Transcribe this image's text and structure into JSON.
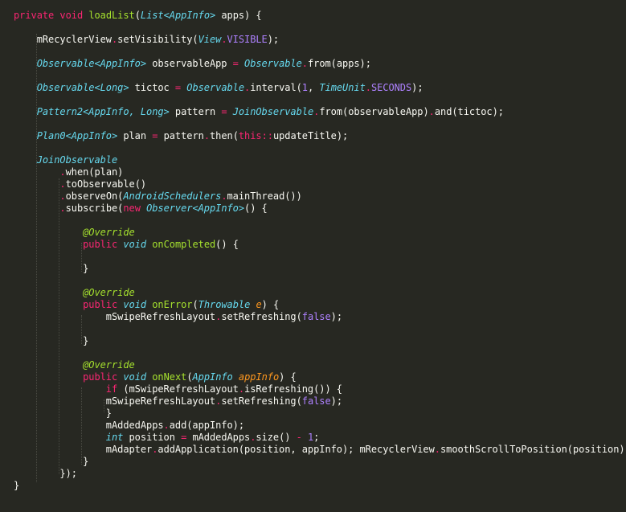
{
  "theme": {
    "background": "#272822",
    "keyword": "#f92672",
    "type": "#66d9ef",
    "function": "#a6e22e",
    "parameter": "#fd971f",
    "constant": "#ae81ff",
    "text": "#f8f8f2"
  },
  "code_lines": [
    [
      [
        "kw",
        "private"
      ],
      [
        "text",
        " "
      ],
      [
        "kw",
        "void"
      ],
      [
        "text",
        " "
      ],
      [
        "func",
        "loadList"
      ],
      [
        "text",
        "("
      ],
      [
        "type",
        "List<AppInfo>"
      ],
      [
        "text",
        " apps) {"
      ]
    ],
    [],
    [
      [
        "text",
        "    mRecyclerView"
      ],
      [
        "kw",
        "."
      ],
      [
        "text",
        "setVisibility("
      ],
      [
        "type",
        "View"
      ],
      [
        "kw",
        "."
      ],
      [
        "const",
        "VISIBLE"
      ],
      [
        "text",
        ");"
      ]
    ],
    [],
    [
      [
        "text",
        "    "
      ],
      [
        "type",
        "Observable<AppInfo>"
      ],
      [
        "text",
        " observableApp "
      ],
      [
        "kw",
        "="
      ],
      [
        "text",
        " "
      ],
      [
        "type",
        "Observable"
      ],
      [
        "kw",
        "."
      ],
      [
        "text",
        "from(apps);"
      ]
    ],
    [],
    [
      [
        "text",
        "    "
      ],
      [
        "type",
        "Observable<Long>"
      ],
      [
        "text",
        " tictoc "
      ],
      [
        "kw",
        "="
      ],
      [
        "text",
        " "
      ],
      [
        "type",
        "Observable"
      ],
      [
        "kw",
        "."
      ],
      [
        "text",
        "interval("
      ],
      [
        "const",
        "1"
      ],
      [
        "text",
        ", "
      ],
      [
        "type",
        "TimeUnit"
      ],
      [
        "kw",
        "."
      ],
      [
        "const",
        "SECONDS"
      ],
      [
        "text",
        ");"
      ]
    ],
    [],
    [
      [
        "text",
        "    "
      ],
      [
        "type",
        "Pattern2<AppInfo, Long>"
      ],
      [
        "text",
        " pattern "
      ],
      [
        "kw",
        "="
      ],
      [
        "text",
        " "
      ],
      [
        "type",
        "JoinObservable"
      ],
      [
        "kw",
        "."
      ],
      [
        "text",
        "from(observableApp)"
      ],
      [
        "kw",
        "."
      ],
      [
        "text",
        "and(tictoc);"
      ]
    ],
    [],
    [
      [
        "text",
        "    "
      ],
      [
        "type",
        "Plan0<AppInfo>"
      ],
      [
        "text",
        " plan "
      ],
      [
        "kw",
        "="
      ],
      [
        "text",
        " pattern"
      ],
      [
        "kw",
        "."
      ],
      [
        "text",
        "then("
      ],
      [
        "kw",
        "this"
      ],
      [
        "kw",
        "::"
      ],
      [
        "text",
        "updateTitle);"
      ]
    ],
    [],
    [
      [
        "text",
        "    "
      ],
      [
        "type",
        "JoinObservable"
      ]
    ],
    [
      [
        "text",
        "        "
      ],
      [
        "kw",
        "."
      ],
      [
        "text",
        "when(plan)"
      ]
    ],
    [
      [
        "text",
        "        "
      ],
      [
        "kw",
        "."
      ],
      [
        "text",
        "toObservable()"
      ]
    ],
    [
      [
        "text",
        "        "
      ],
      [
        "kw",
        "."
      ],
      [
        "text",
        "observeOn("
      ],
      [
        "type",
        "AndroidSchedulers"
      ],
      [
        "kw",
        "."
      ],
      [
        "text",
        "mainThread())"
      ]
    ],
    [
      [
        "text",
        "        "
      ],
      [
        "kw",
        "."
      ],
      [
        "text",
        "subscribe("
      ],
      [
        "kw",
        "new"
      ],
      [
        "text",
        " "
      ],
      [
        "type",
        "Observer<AppInfo>"
      ],
      [
        "text",
        "() {"
      ]
    ],
    [],
    [
      [
        "text",
        "            "
      ],
      [
        "anno",
        "@Override"
      ]
    ],
    [
      [
        "text",
        "            "
      ],
      [
        "kw",
        "public"
      ],
      [
        "text",
        " "
      ],
      [
        "type",
        "void"
      ],
      [
        "text",
        " "
      ],
      [
        "func",
        "onCompleted"
      ],
      [
        "text",
        "() {"
      ]
    ],
    [],
    [
      [
        "text",
        "            }"
      ]
    ],
    [],
    [
      [
        "text",
        "            "
      ],
      [
        "anno",
        "@Override"
      ]
    ],
    [
      [
        "text",
        "            "
      ],
      [
        "kw",
        "public"
      ],
      [
        "text",
        " "
      ],
      [
        "type",
        "void"
      ],
      [
        "text",
        " "
      ],
      [
        "func",
        "onError"
      ],
      [
        "text",
        "("
      ],
      [
        "type",
        "Throwable"
      ],
      [
        "text",
        " "
      ],
      [
        "param",
        "e"
      ],
      [
        "text",
        ") {"
      ]
    ],
    [
      [
        "text",
        "                mSwipeRefreshLayout"
      ],
      [
        "kw",
        "."
      ],
      [
        "text",
        "setRefreshing("
      ],
      [
        "const",
        "false"
      ],
      [
        "text",
        ");"
      ]
    ],
    [],
    [
      [
        "text",
        "            }"
      ]
    ],
    [],
    [
      [
        "text",
        "            "
      ],
      [
        "anno",
        "@Override"
      ]
    ],
    [
      [
        "text",
        "            "
      ],
      [
        "kw",
        "public"
      ],
      [
        "text",
        " "
      ],
      [
        "type",
        "void"
      ],
      [
        "text",
        " "
      ],
      [
        "func",
        "onNext"
      ],
      [
        "text",
        "("
      ],
      [
        "type",
        "AppInfo"
      ],
      [
        "text",
        " "
      ],
      [
        "param",
        "appInfo"
      ],
      [
        "text",
        ") {"
      ]
    ],
    [
      [
        "text",
        "                "
      ],
      [
        "kw",
        "if"
      ],
      [
        "text",
        " (mSwipeRefreshLayout"
      ],
      [
        "kw",
        "."
      ],
      [
        "text",
        "isRefreshing()) {"
      ]
    ],
    [
      [
        "text",
        "                mSwipeRefreshLayout"
      ],
      [
        "kw",
        "."
      ],
      [
        "text",
        "setRefreshing("
      ],
      [
        "const",
        "false"
      ],
      [
        "text",
        ");"
      ]
    ],
    [
      [
        "text",
        "                }"
      ]
    ],
    [
      [
        "text",
        "                mAddedApps"
      ],
      [
        "kw",
        "."
      ],
      [
        "text",
        "add(appInfo);"
      ]
    ],
    [
      [
        "text",
        "                "
      ],
      [
        "type",
        "int"
      ],
      [
        "text",
        " position "
      ],
      [
        "kw",
        "="
      ],
      [
        "text",
        " mAddedApps"
      ],
      [
        "kw",
        "."
      ],
      [
        "text",
        "size() "
      ],
      [
        "kw",
        "-"
      ],
      [
        "text",
        " "
      ],
      [
        "const",
        "1"
      ],
      [
        "text",
        ";"
      ]
    ],
    [
      [
        "text",
        "                mAdapter"
      ],
      [
        "kw",
        "."
      ],
      [
        "text",
        "addApplication(position, appInfo); mRecyclerView"
      ],
      [
        "kw",
        "."
      ],
      [
        "text",
        "smoothScrollToPosition(position);"
      ]
    ],
    [
      [
        "text",
        "            }"
      ]
    ],
    [
      [
        "text",
        "        });"
      ]
    ],
    [
      [
        "text",
        "}"
      ]
    ]
  ]
}
